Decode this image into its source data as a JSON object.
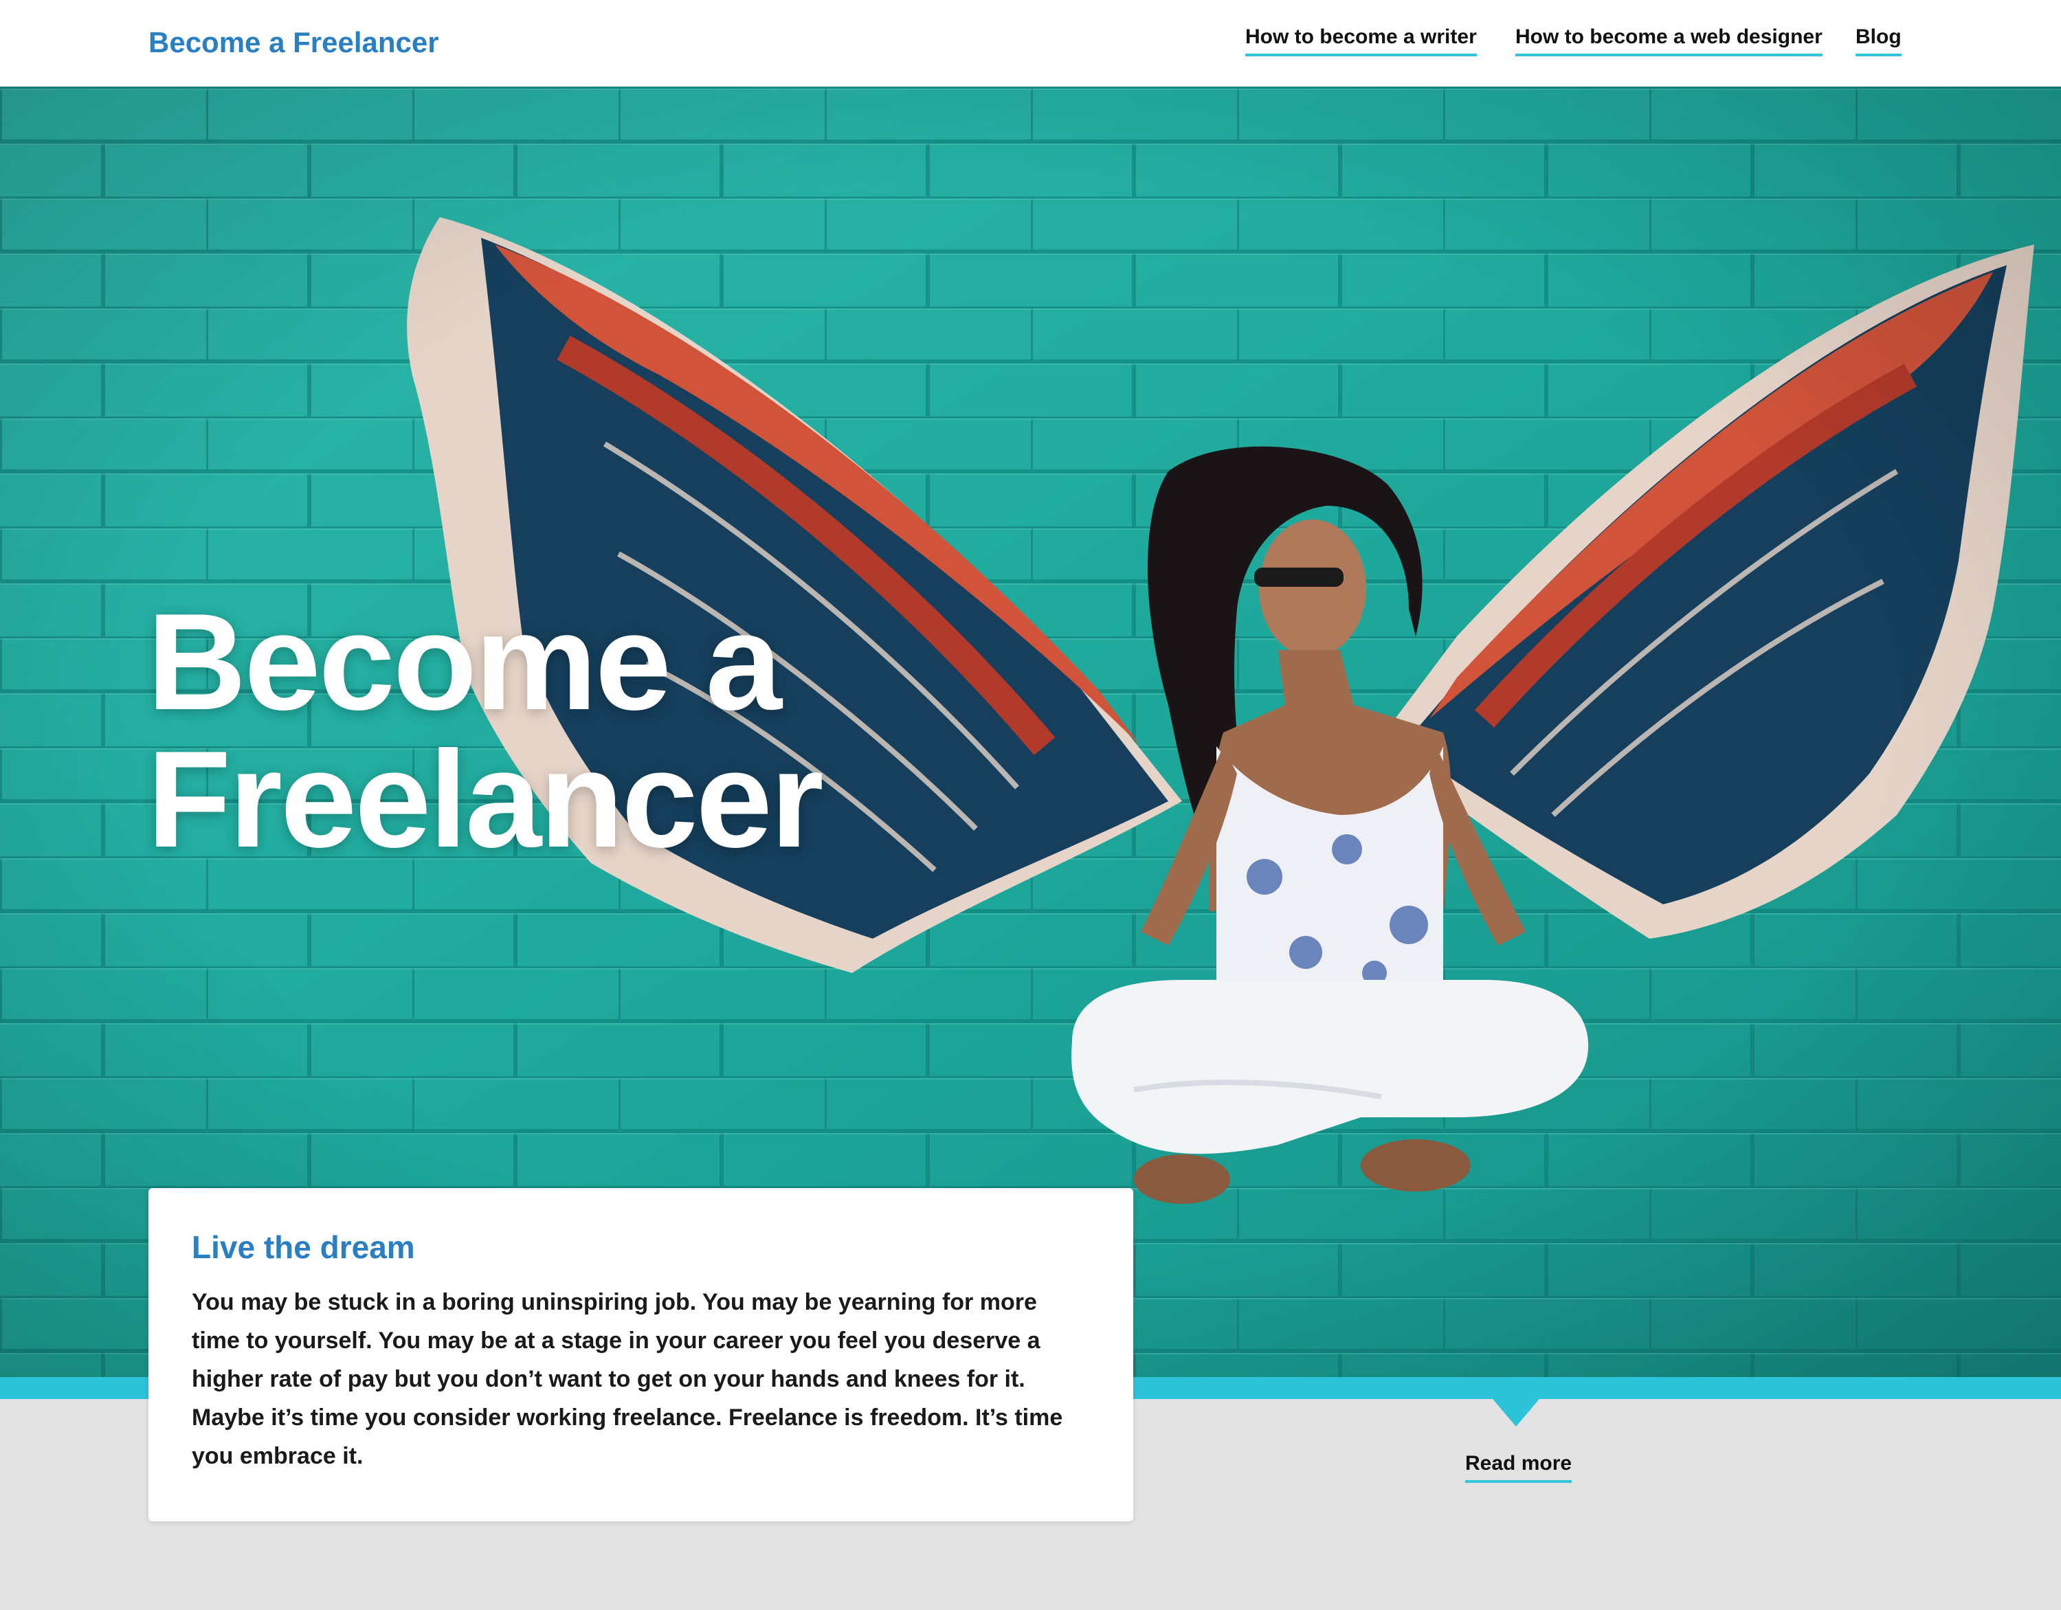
{
  "header": {
    "site_title": "Become a Freelancer",
    "nav": [
      {
        "label": "How to become a writer"
      },
      {
        "label": "How to become a web designer"
      },
      {
        "label": "Blog"
      }
    ]
  },
  "hero": {
    "title_line1": "Become a",
    "title_line2": "Freelancer",
    "image": "woman-with-painted-wings-photo"
  },
  "card": {
    "title": "Live the dream",
    "body": "You may be stuck in a boring uninspiring job. You may be yearning for more time to yourself. You may be at a stage in your career you feel you deserve a higher rate of pay but you don’t want to get on your hands and knees for it. Maybe it’s time you consider working freelance. Freelance is freedom. It’s time you embrace it."
  },
  "read_more": "Read more",
  "colors": {
    "brand_blue": "#2a7fc3",
    "accent_cyan": "#2dc3d8",
    "hero_teal": "#1fb0a4",
    "page_gray": "#e3e3e3"
  }
}
